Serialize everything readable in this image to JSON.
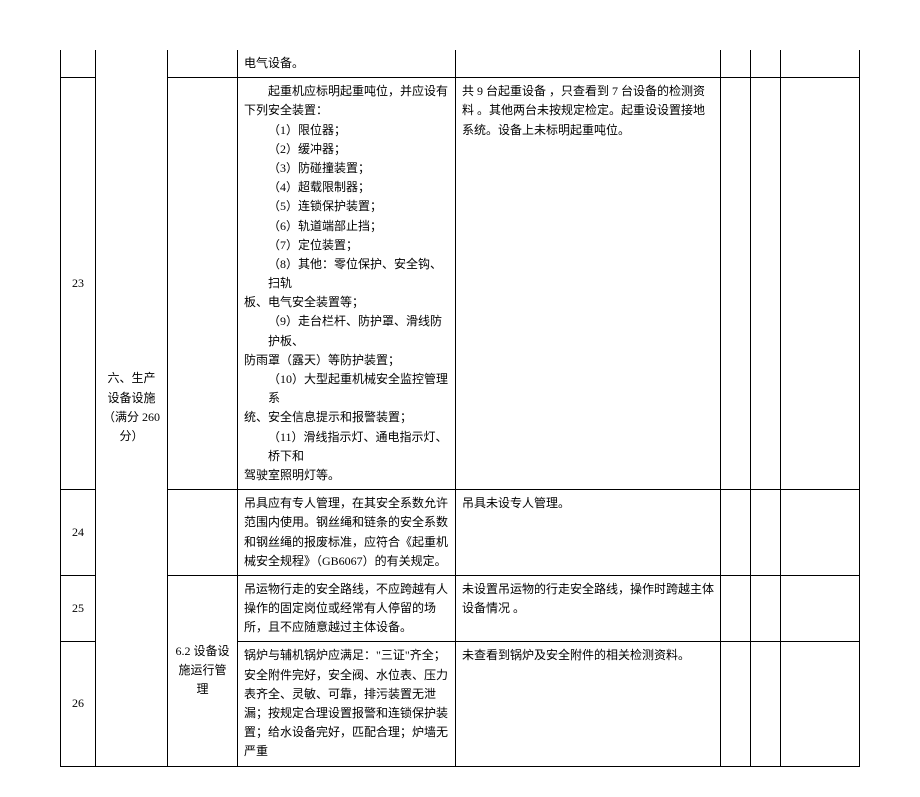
{
  "rows": {
    "top": {
      "std": "电气设备。"
    },
    "r23": {
      "no": "23",
      "category": "六、生产设备设施（满分 260 分）",
      "std_head": "起重机应标明起重吨位，并应设有下列安全装置：",
      "std_items": [
        "（1）限位器；",
        "（2）缓冲器；",
        "（3）防碰撞装置；",
        "（4）超载限制器；",
        "（5）连锁保护装置；",
        "（6）轨道端部止挡；",
        "（7）定位装置；"
      ],
      "std_item8a": "（8）其他：零位保护、安全钩、扫轨",
      "std_item8b": "板、电气安全装置等；",
      "std_item9a": "（9）走台栏杆、防护罩、滑线防护板、",
      "std_item9b": "防雨罩（露天）等防护装置；",
      "std_item10a": "（10）大型起重机械安全监控管理系",
      "std_item10b": "统、安全信息提示和报警装置；",
      "std_item11a": "（11）滑线指示灯、通电指示灯、桥下和",
      "std_item11b": "驾驶室照明灯等。",
      "find": "共 9 台起重设备 ，只查看到 7 台设备的检测资料 。其他两台未按规定检定。起重设设置接地系统。设备上未标明起重吨位。"
    },
    "r24": {
      "no": "24",
      "std": "吊具应有专人管理，在其安全系数允许范围内使用。钢丝绳和链条的安全系数和钢丝绳的报废标准，应符合《起重机械安全规程》（GB6067）的有关规定。",
      "find": "吊具未设专人管理。"
    },
    "r25": {
      "no": "25",
      "section": "6.2 设备设施运行管理",
      "std": "吊运物行走的安全路线，不应跨越有人操作的固定岗位或经常有人停留的场所，且不应随意越过主体设备。",
      "find": "未设置吊运物的行走安全路线，操作时跨越主体设备情况 。"
    },
    "r26": {
      "no": "26",
      "std": "锅炉与辅机锅炉应满足：\"三证\"齐全；安全附件完好，安全阀、水位表、压力表齐全、灵敏、可靠，排污装置无泄漏；按规定合理设置报警和连锁保护装置；给水设备完好，匹配合理；炉墙无严重",
      "find": "未查看到锅炉及安全附件的相关检测资料。"
    }
  }
}
